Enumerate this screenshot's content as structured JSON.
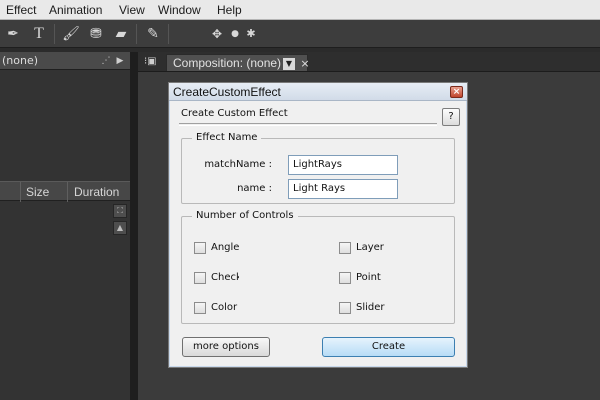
{
  "menu": [
    "Effect",
    "Animation",
    "View",
    "Window",
    "Help"
  ],
  "project_panel": {
    "tab_label": "(none)",
    "columns": [
      "Size",
      "Duration"
    ]
  },
  "composition": {
    "tab_label": "Composition: (none)",
    "close_glyph": "×"
  },
  "dialog": {
    "title": "CreateCustomEffect",
    "header": "Create Custom Effect",
    "help_label": "?",
    "effect_name": {
      "legend": "Effect Name",
      "match_name_label": "matchName :",
      "match_name_value": "LightRays",
      "name_label": "name :",
      "name_value": "Light Rays"
    },
    "controls": {
      "legend": "Number of Controls",
      "checkboxes": [
        "Angle",
        "Layer",
        "Checkbox",
        "Point",
        "Color",
        "Slider"
      ]
    },
    "buttons": {
      "more_options": "more options",
      "create": "Create"
    }
  },
  "colors": {
    "accent": "#3c7fb1",
    "panel_bg": "#3b3b3b"
  }
}
